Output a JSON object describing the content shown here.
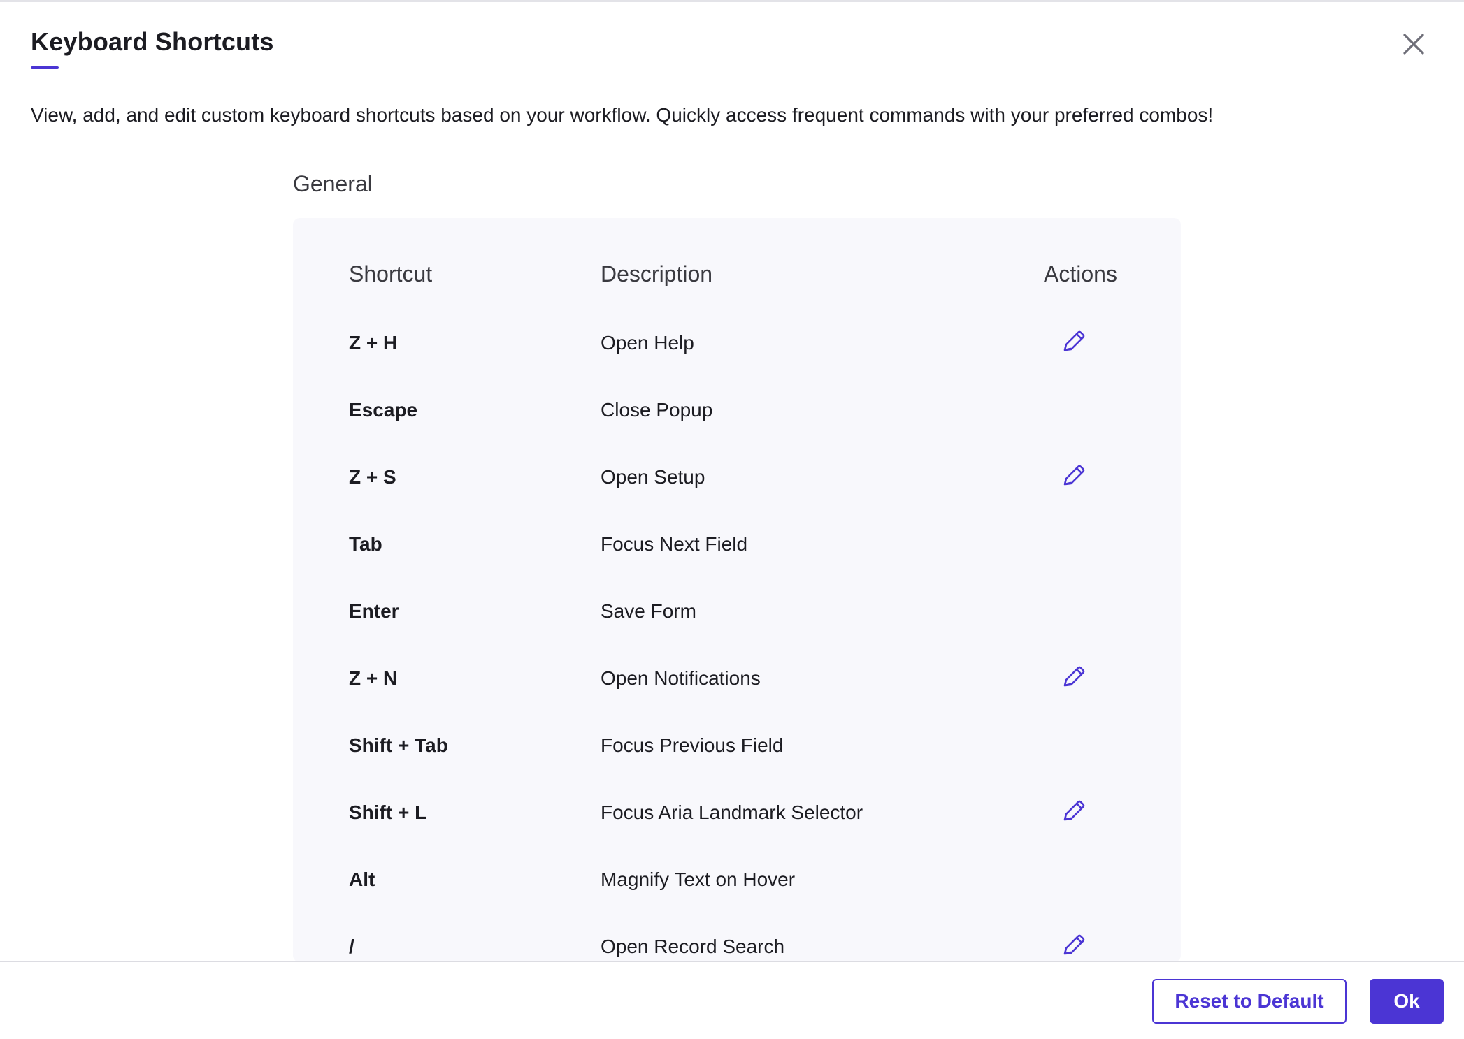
{
  "dialog": {
    "title": "Keyboard Shortcuts",
    "description": "View, add, and edit custom keyboard shortcuts based on your workflow. Quickly access frequent commands with your preferred combos!",
    "close_icon": "close-icon"
  },
  "section": {
    "title": "General"
  },
  "table": {
    "headers": {
      "shortcut": "Shortcut",
      "description": "Description",
      "actions": "Actions"
    },
    "rows": [
      {
        "shortcut": "Z + H",
        "description": "Open Help",
        "editable": true
      },
      {
        "shortcut": "Escape",
        "description": "Close Popup",
        "editable": false
      },
      {
        "shortcut": "Z + S",
        "description": "Open Setup",
        "editable": true
      },
      {
        "shortcut": "Tab",
        "description": "Focus Next Field",
        "editable": false
      },
      {
        "shortcut": "Enter",
        "description": "Save Form",
        "editable": false
      },
      {
        "shortcut": "Z + N",
        "description": "Open Notifications",
        "editable": true
      },
      {
        "shortcut": "Shift + Tab",
        "description": "Focus Previous Field",
        "editable": false
      },
      {
        "shortcut": "Shift + L",
        "description": "Focus Aria Landmark Selector",
        "editable": true
      },
      {
        "shortcut": "Alt",
        "description": "Magnify Text on Hover",
        "editable": false
      },
      {
        "shortcut": "/",
        "description": "Open Record Search",
        "editable": true
      }
    ],
    "edit_icon": "pencil-icon"
  },
  "footer": {
    "reset_label": "Reset to Default",
    "ok_label": "Ok"
  },
  "colors": {
    "accent": "#4b35d4",
    "table_background": "#f8f8fc",
    "text": "#1c1c22"
  }
}
